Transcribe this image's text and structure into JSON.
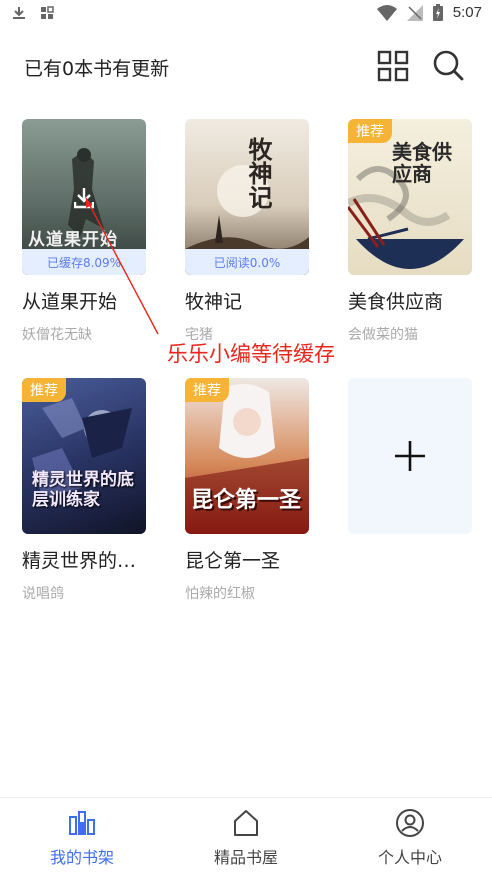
{
  "status_bar": {
    "time": "5:07",
    "left_icons": [
      "download-icon",
      "app-grid-icon"
    ],
    "right_icons": [
      "wifi-icon",
      "no-signal-icon",
      "battery-icon"
    ]
  },
  "header": {
    "title": "已有0本书有更新",
    "icons": [
      "grid-view-icon",
      "search-icon"
    ]
  },
  "books": [
    {
      "title": "从道果开始",
      "author": "妖僧花无缺",
      "progress_label": "已缓存8.09%",
      "tag": "",
      "cover_text": "从道果开始",
      "cover_colors": [
        "#7d8f86",
        "#3f4b47"
      ]
    },
    {
      "title": "牧神记",
      "author": "宅猪",
      "progress_label": "已阅读0.0%",
      "tag": "",
      "cover_text": "牧神记",
      "cover_colors": [
        "#efe8dc",
        "#5a4a3a"
      ]
    },
    {
      "title": "美食供应商",
      "author": "会做菜的猫",
      "progress_label": "",
      "tag": "推荐",
      "cover_text": "美食供应商",
      "cover_colors": [
        "#f1ebd8",
        "#1e2f55"
      ]
    },
    {
      "title": "精灵世界的…",
      "author": "说唱鸽",
      "progress_label": "",
      "tag": "推荐",
      "cover_text": "精灵世界的底层训练家",
      "cover_colors": [
        "#2c3b6e",
        "#141a33"
      ]
    },
    {
      "title": "昆仑第一圣",
      "author": "怕辣的红椒",
      "progress_label": "",
      "tag": "推荐",
      "cover_text": "昆仑第一圣",
      "cover_colors": [
        "#e9e2de",
        "#a8241a"
      ]
    }
  ],
  "add_book": {
    "icon": "plus-icon"
  },
  "annotation": {
    "text": "乐乐小编等待缓存",
    "color": "#e8261c"
  },
  "bottom_nav": {
    "items": [
      {
        "label": "我的书架",
        "icon": "bookshelf-icon",
        "active": true
      },
      {
        "label": "精品书屋",
        "icon": "home-icon",
        "active": false
      },
      {
        "label": "个人中心",
        "icon": "user-icon",
        "active": false
      }
    ],
    "active_color": "#3f6ff0"
  }
}
